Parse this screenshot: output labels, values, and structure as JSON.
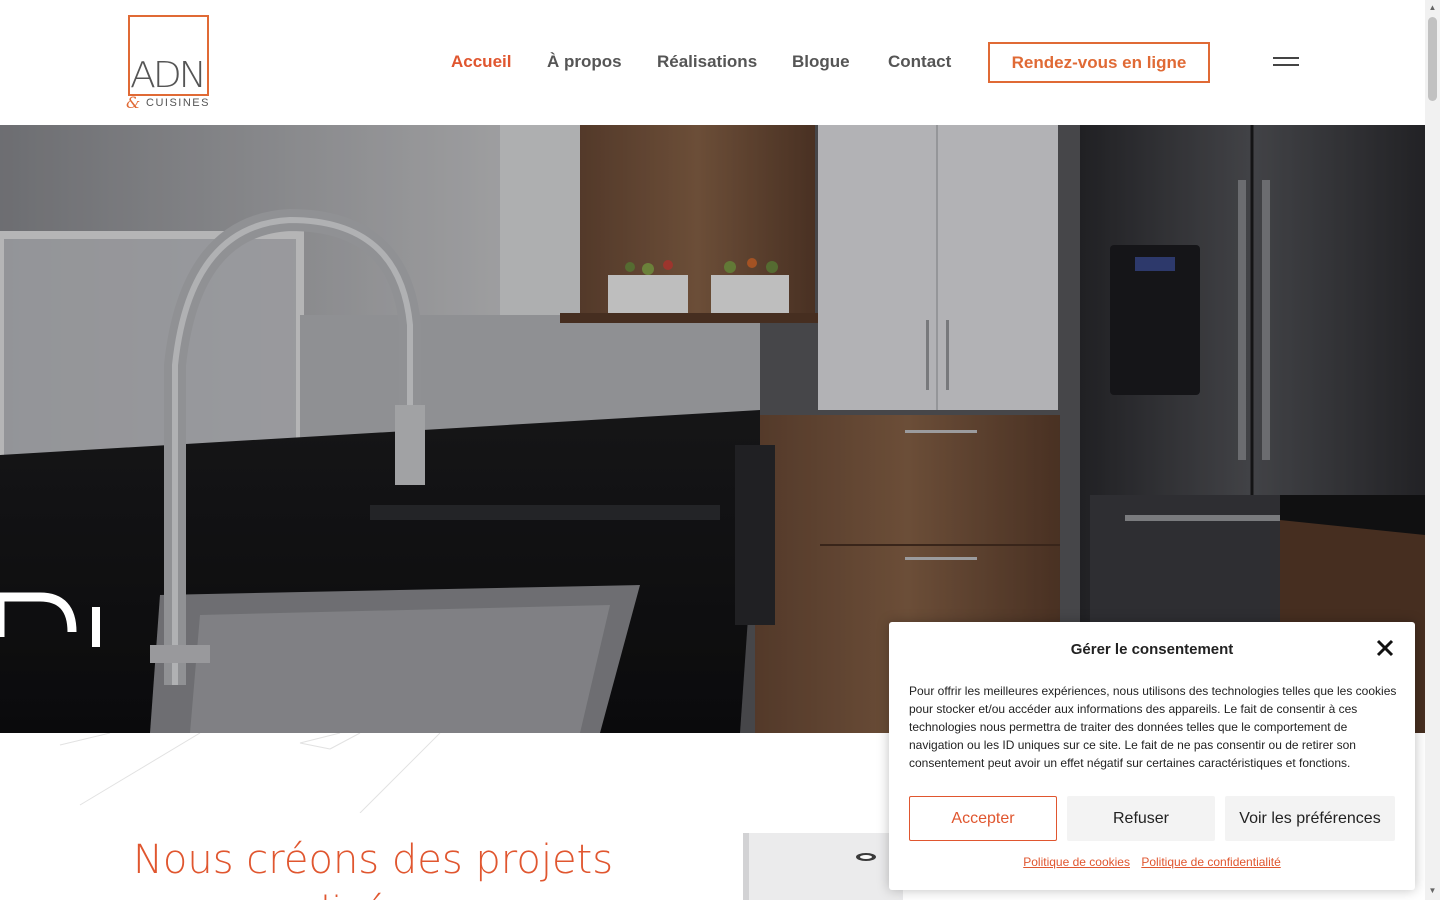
{
  "brand": {
    "logo_text": "ADN",
    "logo_ampersand": "&",
    "logo_subtitle": "CUISINES",
    "accent_color": "#e0562f"
  },
  "nav": {
    "items": [
      {
        "label": "Accueil",
        "active": true
      },
      {
        "label": "À propos",
        "active": false
      },
      {
        "label": "Réalisations",
        "active": false
      },
      {
        "label": "Blogue",
        "active": false
      },
      {
        "label": "Contact",
        "active": false
      }
    ],
    "cta_label": "Rendez-vous en ligne",
    "menu_icon": "hamburger-icon"
  },
  "hero": {
    "image_subject": "kitchen-photo",
    "overlay_text": "Di"
  },
  "intro": {
    "headline": "Nous créons des projets personnalisés pour"
  },
  "consent": {
    "title": "Gérer le consentement",
    "body": "Pour offrir les meilleures expériences, nous utilisons des technologies telles que les cookies pour stocker et/ou accéder aux informations des appareils. Le fait de consentir à ces technologies nous permettra de traiter des données telles que le comportement de navigation ou les ID uniques sur ce site. Le fait de ne pas consentir ou de retirer son consentement peut avoir un effet négatif sur certaines caractéristiques et fonctions.",
    "accept_label": "Accepter",
    "refuse_label": "Refuser",
    "prefs_label": "Voir les préférences",
    "cookie_policy_label": "Politique de cookies",
    "privacy_policy_label": "Politique de confidentialité",
    "close_icon": "close-icon"
  }
}
